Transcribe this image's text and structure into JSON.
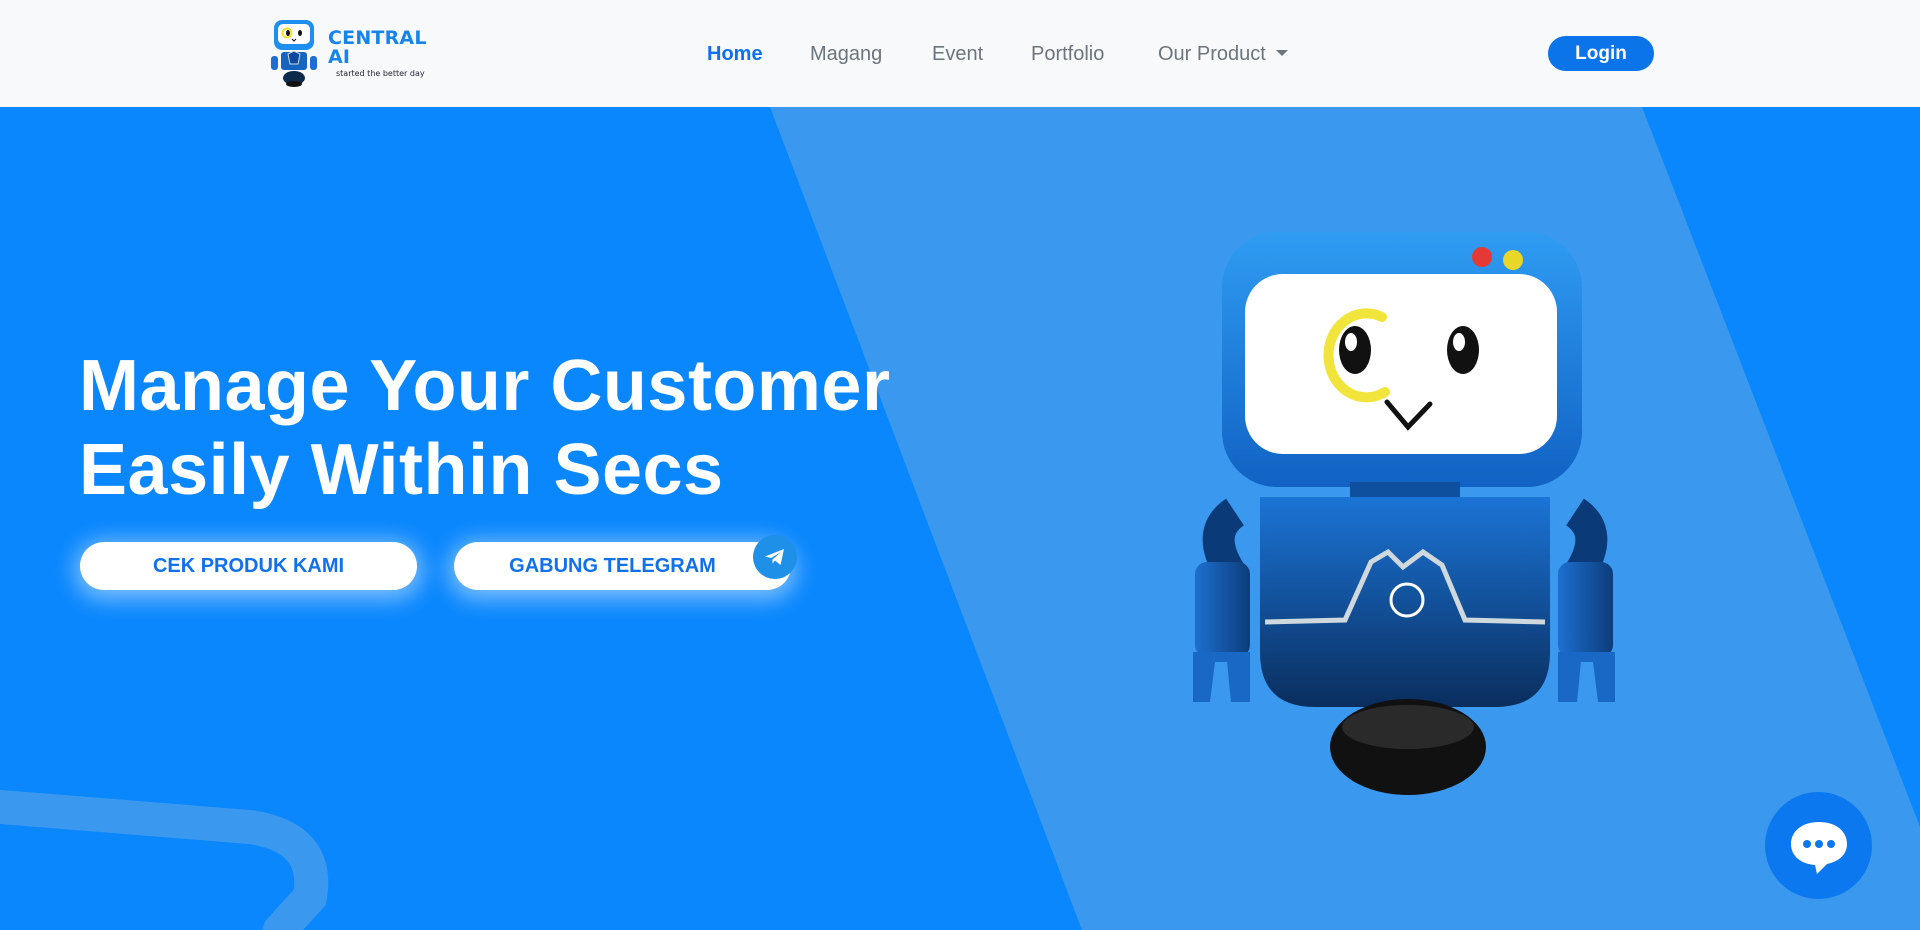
{
  "brand": {
    "name": "CENTRAL AI",
    "tagline": "started the better day",
    "logo_icon": "robot-mascot-icon"
  },
  "nav": {
    "items": [
      {
        "label": "Home",
        "active": true
      },
      {
        "label": "Magang",
        "active": false
      },
      {
        "label": "Event",
        "active": false
      },
      {
        "label": "Portfolio",
        "active": false
      },
      {
        "label": "Our Product",
        "active": false,
        "dropdown": true
      }
    ],
    "login_label": "Login"
  },
  "hero": {
    "headline_line1": "Manage Your Customer",
    "headline_line2": "Easily Within Secs",
    "primary_button": "CEK PRODUK KAMI",
    "secondary_button": "GABUNG TELEGRAM",
    "secondary_icon": "telegram-icon",
    "illustration": "robot-mascot-image"
  },
  "chat_widget": {
    "icon": "chat-bubble-icon"
  },
  "colors": {
    "hero_bg": "#0a87fd",
    "stripe": "#3a99ef",
    "nav_bg": "#f8f9fa",
    "accent": "#1171e8",
    "nav_text": "#6c757d",
    "white": "#ffffff"
  }
}
